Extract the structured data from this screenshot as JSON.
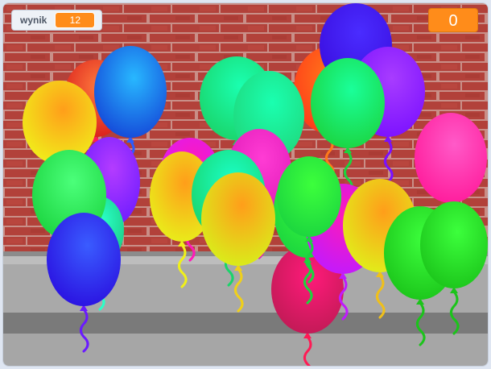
{
  "variable_monitor": {
    "name": "wynik",
    "value": "12"
  },
  "score_display": {
    "value": "0"
  },
  "colors": {
    "brick": "#b2413a",
    "mortar": "#c98f88",
    "pavement": "#a9a9a9",
    "curb": "#7a7a7a",
    "monitor_accent": "#ff8c1a"
  },
  "balloons": [
    {
      "c1": "#ff7a3d",
      "c2": "#d81b1b",
      "string": "#ff1a55"
    },
    {
      "c1": "#28b8ff",
      "c2": "#1446d8",
      "string": "#2a5cff"
    },
    {
      "c1": "#ff9e1a",
      "c2": "#f0f01a",
      "string": "#f0f01a"
    },
    {
      "c1": "#b43cff",
      "c2": "#6a1aff",
      "string": "#9a1aff"
    },
    {
      "c1": "#2affc8",
      "c2": "#19c57a",
      "string": "#2affc8"
    },
    {
      "c1": "#4bff7a",
      "c2": "#1bd43f",
      "string": "#1bd43f"
    },
    {
      "c1": "#3a5cff",
      "c2": "#2a10e0",
      "string": "#6a1aff"
    },
    {
      "c1": "#ff1ab8",
      "c2": "#d61aff",
      "string": "#ff1ab8"
    },
    {
      "c1": "#ff7a1a",
      "c2": "#ff3a1a",
      "string": "#ff7a1a"
    },
    {
      "c1": "#1affb0",
      "c2": "#1ad46a",
      "string": "#1ad46a"
    },
    {
      "c1": "#1affb0",
      "c2": "#1fd77a",
      "string": "#1fd77a"
    },
    {
      "c1": "#4a2cff",
      "c2": "#3a0ee0",
      "string": "#3a0ee0"
    },
    {
      "c1": "#a83cff",
      "c2": "#7a10ff",
      "string": "#7a10ff"
    },
    {
      "c1": "#1aff9a",
      "c2": "#1bd43f",
      "string": "#1bd43f"
    },
    {
      "c1": "#ff3cd4",
      "c2": "#e01ab8",
      "string": "#e01ab8"
    },
    {
      "c1": "#ff5ac8",
      "c2": "#ff1a9a",
      "string": "#ff1a9a"
    },
    {
      "c1": "#ff9e1a",
      "c2": "#e8f01a",
      "string": "#f0f01a"
    },
    {
      "c1": "#1affc8",
      "c2": "#1ad46a",
      "string": "#1ad46a"
    },
    {
      "c1": "#ff1a7a",
      "c2": "#c01a55",
      "string": "#ff1a55"
    },
    {
      "c1": "#3cff3c",
      "c2": "#1bd43f",
      "string": "#1bd43f"
    },
    {
      "c1": "#ff1ab8",
      "c2": "#c01aff",
      "string": "#c01aff"
    },
    {
      "c1": "#ff9e1a",
      "c2": "#e0f01a",
      "string": "#f0c01a"
    },
    {
      "c1": "#3cff3c",
      "c2": "#1bc41a",
      "string": "#1bc41a"
    },
    {
      "c1": "#3cff3c",
      "c2": "#1bc41a",
      "string": "#1bc41a"
    },
    {
      "c1": "#ff9e1a",
      "c2": "#d8f01a",
      "string": "#f0d01a"
    },
    {
      "c1": "#3cff3c",
      "c2": "#1bd43f",
      "string": "#1bd43f"
    }
  ]
}
